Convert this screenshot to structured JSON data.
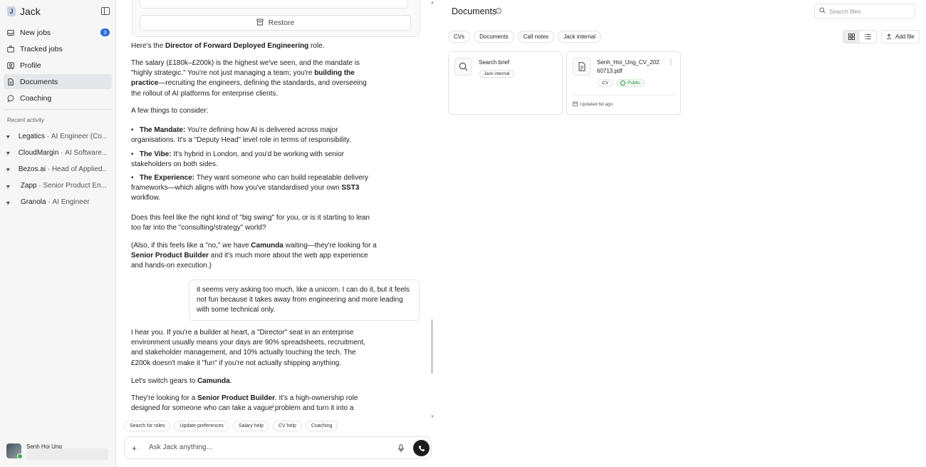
{
  "sidebar": {
    "brand": "Jack",
    "nav": [
      {
        "label": "New jobs",
        "icon": "inbox-icon",
        "badge": "3"
      },
      {
        "label": "Tracked jobs",
        "icon": "briefcase-icon"
      },
      {
        "label": "Profile",
        "icon": "profile-icon"
      },
      {
        "label": "Documents",
        "icon": "document-icon",
        "active": true
      },
      {
        "label": "Coaching",
        "icon": "chat-icon"
      }
    ],
    "recent_label": "Recent activity",
    "recent": [
      {
        "company": "Legatics",
        "role": "AI Engineer (Co..."
      },
      {
        "company": "CloudMargin",
        "role": "AI Software..."
      },
      {
        "company": "Bezos.ai",
        "role": "Head of Applied..."
      },
      {
        "company": "Zapp",
        "role": "Senior Product En..."
      },
      {
        "company": "Granola",
        "role": "AI Engineer"
      }
    ],
    "user_name": "Senh Hoi Ung"
  },
  "chat": {
    "restore_label": "Restore",
    "p1": {
      "pre": "Here's the ",
      "bold": "Director of Forward Deployed Engineering",
      "post": " role."
    },
    "p2": {
      "pre": "The salary (£180k–£200k) is the highest we've seen, and the mandate is \"highly strategic.\" You're not just managing a team; you're ",
      "bold": "building the practice",
      "post": "—recruiting the engineers, defining the standards, and overseeing the rollout of AI platforms for enterprise clients."
    },
    "p3": "A few things to consider:",
    "bullets": [
      {
        "bold": "The Mandate:",
        "text": " You're defining how AI is delivered across major organisations. It's a \"Deputy Head\" level role in terms of responsibility."
      },
      {
        "bold": "The Vibe:",
        "text": " It's hybrid in London, and you'd be working with senior stakeholders on both sides."
      },
      {
        "bold": "The Experience:",
        "text": " They want someone who can build repeatable delivery frameworks—which aligns with how you've standardised your own ",
        "bold2": "SST3",
        "post": " workflow."
      }
    ],
    "p4": "Does this feel like the right kind of \"big swing\" for you, or is it starting to lean too far into the \"consulting/strategy\" world?",
    "p5": {
      "pre": "(Also, if this feels like a \"no,\" we have ",
      "bold": "Camunda",
      "mid": " waiting—they're looking for a ",
      "bold2": "Senior Product Builder",
      "post": " and it's much more about the web app experience and hands-on execution.)"
    },
    "user_msg": "it seems very asking too much, like a unicorn. I can do it, but it feels not fun because it takes away from engineering and more leading with some technical only.",
    "p6": "I hear you. If you're a builder at heart, a \"Director\" seat in an enterprise environment usually means your days are 90% spreadsheets, recruitment, and stakeholder management, and 10% actually touching the tech. The £200k doesn't make it \"fun\" if you're not actually shipping anything.",
    "p7": {
      "pre": "Let's switch gears to ",
      "bold": "Camunda",
      "post": "."
    },
    "p8": {
      "pre": "They're looking for a ",
      "bold": "Senior Product Builder",
      "post": ". It's a high-ownership role designed for someone who can take a vague problem and turn it into a shipped outcome"
    },
    "chips": [
      "Search for roles",
      "Update preferences",
      "Salary help",
      "CV help",
      "Coaching"
    ],
    "composer_placeholder": "Ask Jack anything..."
  },
  "documents": {
    "title": "Documents",
    "search_placeholder": "Search files",
    "tabs": [
      "CVs",
      "Documents",
      "Call notes",
      "Jack internal"
    ],
    "add_file_label": "Add file",
    "cards": [
      {
        "title": "Search brief",
        "tag": "Jack internal",
        "icon": "search-icon"
      },
      {
        "title": "Senh_Hoi_Ung_CV_20260713.pdf",
        "title_line1": "Senh_Hoi_Ung_CV_202",
        "title_line2": "60713.pdf",
        "tag": "CV",
        "visibility": "Public",
        "updated": "Updated 6d ago",
        "icon": "file-icon"
      }
    ]
  },
  "colors": {
    "accent": "#2e6bd9",
    "public_green": "#2f8a3e",
    "active_nav": "#e4e6ea"
  }
}
